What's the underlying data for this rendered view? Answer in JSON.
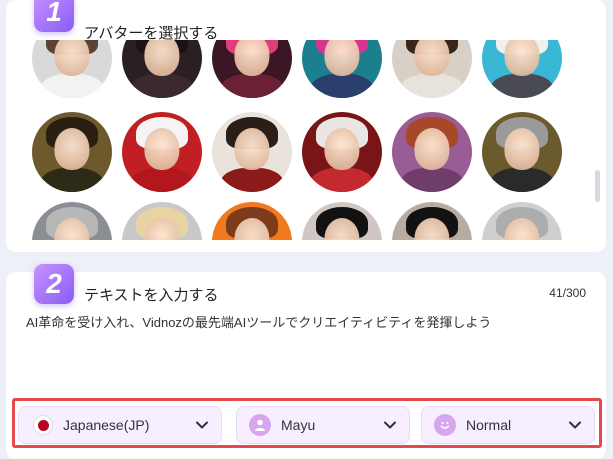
{
  "step1": {
    "number": "1",
    "title": "アバターを選択する"
  },
  "step2": {
    "number": "2",
    "title": "テキストを入力する",
    "counter": "41/300",
    "text": "AI革命を受け入れ、Vidnozの最先端AIツールでクリエイティビティを発揮しよう"
  },
  "avatars": [
    {
      "name": "man-white-shirt",
      "bg": "#d9d9d9",
      "hair": "#5a4334",
      "body": "#f2f2f2"
    },
    {
      "name": "dark-hair-woman",
      "bg": "#2a1f24",
      "hair": "#1a1214",
      "body": "#3a2a2e"
    },
    {
      "name": "pink-hair-anime",
      "bg": "#3b1726",
      "hair": "#e03e7a",
      "body": "#6b2036"
    },
    {
      "name": "teal-pink-hair",
      "bg": "#1c7f8e",
      "hair": "#d6358f",
      "body": "#2b3f6e"
    },
    {
      "name": "brunette-woman",
      "bg": "#d8cfc6",
      "hair": "#3a2518",
      "body": "#e8e2dc"
    },
    {
      "name": "einstein",
      "bg": "#3bb7d6",
      "hair": "#f0f0f0",
      "body": "#4a4a55"
    },
    {
      "name": "mona-lisa",
      "bg": "#6c5a2c",
      "hair": "#2a1f10",
      "body": "#2e2a18"
    },
    {
      "name": "santa",
      "bg": "#c21f24",
      "hair": "#f4f4f4",
      "body": "#b3161c"
    },
    {
      "name": "man-red-jacket",
      "bg": "#e9e3dc",
      "hair": "#2a1e16",
      "body": "#8b1b1b"
    },
    {
      "name": "grandma-santa-hat",
      "bg": "#7a1517",
      "hair": "#e9e6e3",
      "body": "#c22a2f"
    },
    {
      "name": "redhead-woman",
      "bg": "#9a5c94",
      "hair": "#a8482a",
      "body": "#6e3d6a"
    },
    {
      "name": "older-man",
      "bg": "#6a5a2c",
      "hair": "#9a9a9a",
      "body": "#2a2a2a"
    },
    {
      "name": "man-suit",
      "bg": "#8a8f95",
      "hair": "#b7b7b7",
      "body": "#2c2f38"
    },
    {
      "name": "blonde-woman",
      "bg": "#c8c8c8",
      "hair": "#e7d3a4",
      "body": "#e0e0e0"
    },
    {
      "name": "auburn-woman",
      "bg": "#f07a1d",
      "hair": "#7d3b1c",
      "body": "#2a2a2a"
    },
    {
      "name": "dark-skin-woman",
      "bg": "#d0c7c2",
      "hair": "#111111",
      "body": "#ececec"
    },
    {
      "name": "curly-man",
      "bg": "#b6aca2",
      "hair": "#121212",
      "body": "#ffffff"
    },
    {
      "name": "gray-man",
      "bg": "#cfcfcf",
      "hair": "#adadad",
      "body": "#3a3a3a"
    }
  ],
  "selects": {
    "language": "Japanese(JP)",
    "voice": "Mayu",
    "style": "Normal"
  },
  "colors": {
    "accent": "#8a5cf5",
    "highlight": "#e5484d",
    "select_bg": "#f7efff"
  }
}
